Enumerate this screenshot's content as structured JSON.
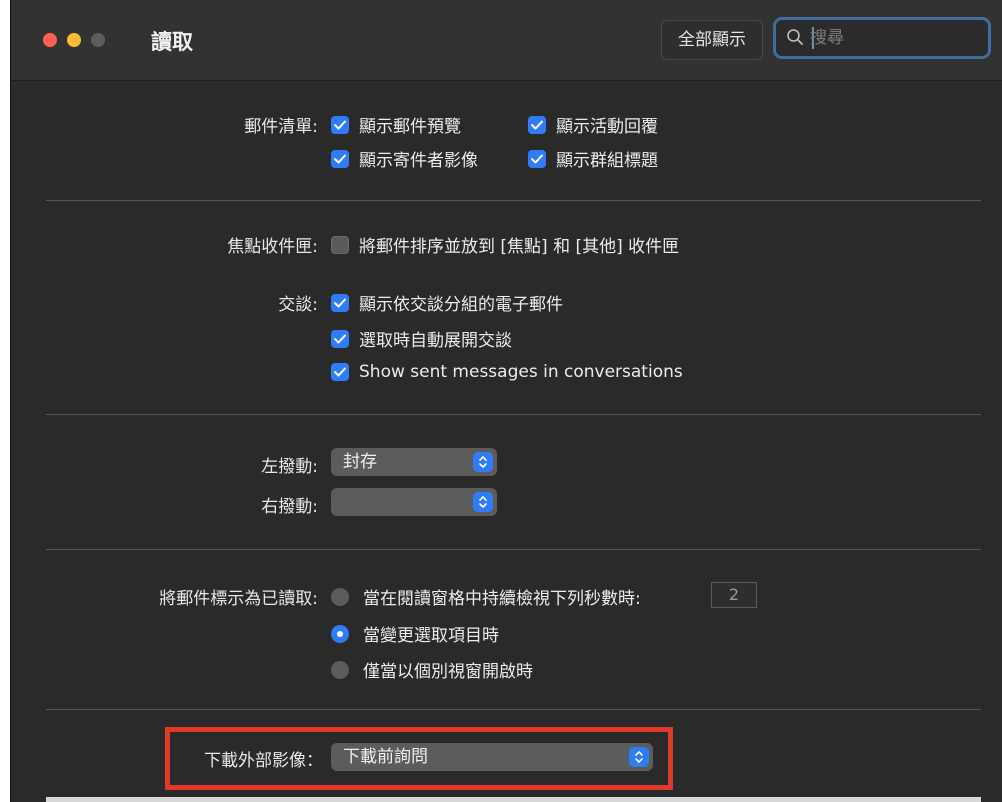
{
  "window": {
    "title": "讀取",
    "show_all_label": "全部顯示",
    "search": {
      "placeholder": "搜尋",
      "value": ""
    }
  },
  "mail_list": {
    "label": "郵件清單:",
    "options": [
      {
        "label": "顯示郵件預覽",
        "checked": true
      },
      {
        "label": "顯示活動回覆",
        "checked": true
      },
      {
        "label": "顯示寄件者影像",
        "checked": true
      },
      {
        "label": "顯示群組標題",
        "checked": true
      }
    ]
  },
  "focused_inbox": {
    "label": "焦點收件匣:",
    "option": {
      "label": "將郵件排序並放到 [焦點] 和 [其他] 收件匣",
      "checked": false
    }
  },
  "conversations": {
    "label": "交談:",
    "options": [
      {
        "label": "顯示依交談分組的電子郵件",
        "checked": true
      },
      {
        "label": "選取時自動展開交談",
        "checked": true
      },
      {
        "label": "Show sent messages in conversations",
        "checked": true
      }
    ]
  },
  "swipe": {
    "left_label": "左撥動:",
    "left_value": "封存",
    "right_label": "右撥動:",
    "right_value": ""
  },
  "mark_read": {
    "label": "將郵件標示為已讀取:",
    "options": [
      {
        "label": "當在閱讀窗格中持續檢視下列秒數時:",
        "selected": false
      },
      {
        "label": "當變更選取項目時",
        "selected": true
      },
      {
        "label": "僅當以個別視窗開啟時",
        "selected": false
      }
    ],
    "seconds": "2"
  },
  "external_images": {
    "label": "下載外部影像：",
    "value": "下載前詢問"
  },
  "colors": {
    "accent": "#2f7cf6",
    "highlight": "#e0392a",
    "background": "#2a2a2a"
  }
}
